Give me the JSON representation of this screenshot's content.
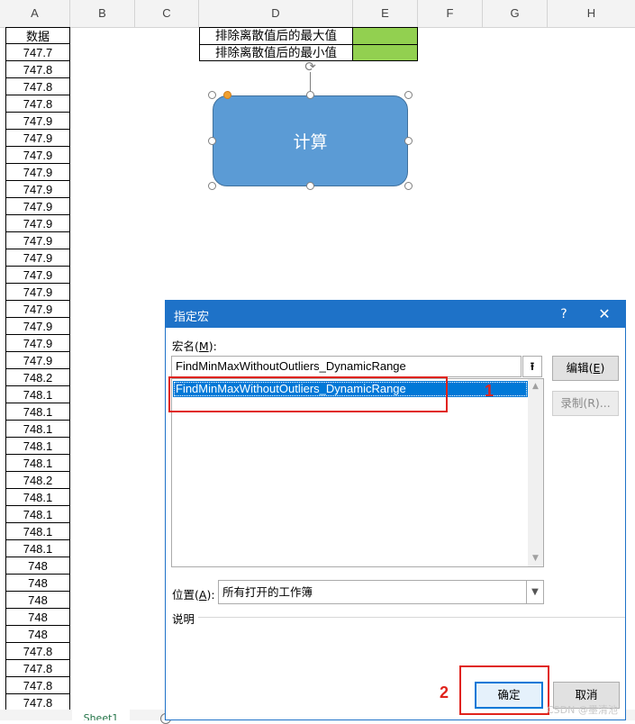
{
  "spreadsheet": {
    "columns": [
      "A",
      "B",
      "C",
      "D",
      "E",
      "F",
      "G",
      "H"
    ],
    "column_a_header": "数据",
    "column_a_values": [
      "747.7",
      "747.8",
      "747.8",
      "747.8",
      "747.9",
      "747.9",
      "747.9",
      "747.9",
      "747.9",
      "747.9",
      "747.9",
      "747.9",
      "747.9",
      "747.9",
      "747.9",
      "747.9",
      "747.9",
      "747.9",
      "747.9",
      "748.2",
      "748.1",
      "748.1",
      "748.1",
      "748.1",
      "748.1",
      "748.2",
      "748.1",
      "748.1",
      "748.1",
      "748.1",
      "748",
      "748",
      "748",
      "748",
      "748",
      "747.8",
      "747.8",
      "747.8",
      "747.8"
    ],
    "d_rows": [
      {
        "label": "排除离散值后的最大值"
      },
      {
        "label": "排除离散值后的最小值"
      }
    ],
    "result_fill_color": "#92d050",
    "sheet_tab": "Sheet1"
  },
  "shape": {
    "label": "计算",
    "fill_color": "#5b9bd5"
  },
  "dialog": {
    "title": "指定宏",
    "help_label": "?",
    "close_label": "✕",
    "macro_name_label_pre": "宏名(",
    "macro_name_label_key": "M",
    "macro_name_label_post": "):",
    "macro_name_value": "FindMinMaxWithoutOutliers_DynamicRange",
    "macro_list": [
      "FindMinMaxWithoutOutliers_DynamicRange"
    ],
    "edit_button_pre": "编辑(",
    "edit_button_key": "E",
    "edit_button_post": ")",
    "record_button": "录制(R)...",
    "location_label_pre": "位置(",
    "location_label_key": "A",
    "location_label_post": "):",
    "location_value": "所有打开的工作簿",
    "description_label": "说明",
    "ok_button": "确定",
    "cancel_button": "取消"
  },
  "annotations": {
    "marker_1": "1",
    "marker_2": "2",
    "color": "#e0231c"
  },
  "watermark": "CSDN @墨清池"
}
